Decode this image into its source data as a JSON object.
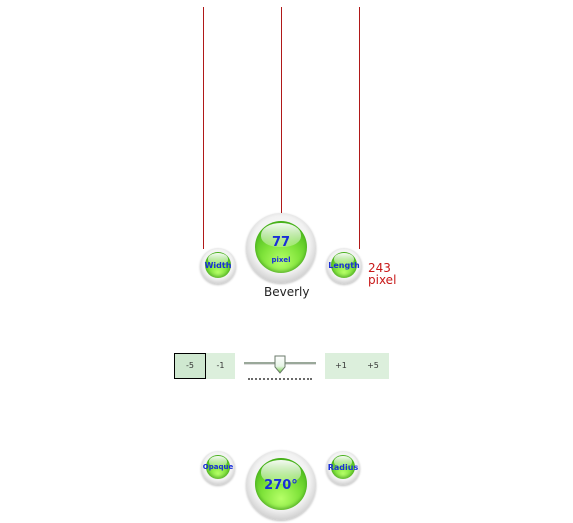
{
  "size_control": {
    "value": "77",
    "unit": "pixel",
    "name": "Beverly",
    "width_label": "Width",
    "length_label": "Length",
    "length_value": "243",
    "length_unit": "pixel"
  },
  "step_buttons": [
    "-5",
    "-1",
    "+1",
    "+5"
  ],
  "slider": {
    "level": 0.5
  },
  "rotation_control": {
    "value": "270°",
    "opaque_label": "Opaque",
    "radius_label": "Radius"
  },
  "colors": {
    "line": "#b01818",
    "knob_green": "#7fe33a",
    "knob_text": "#1a2fd8",
    "button_bg": "#dcefdc"
  }
}
